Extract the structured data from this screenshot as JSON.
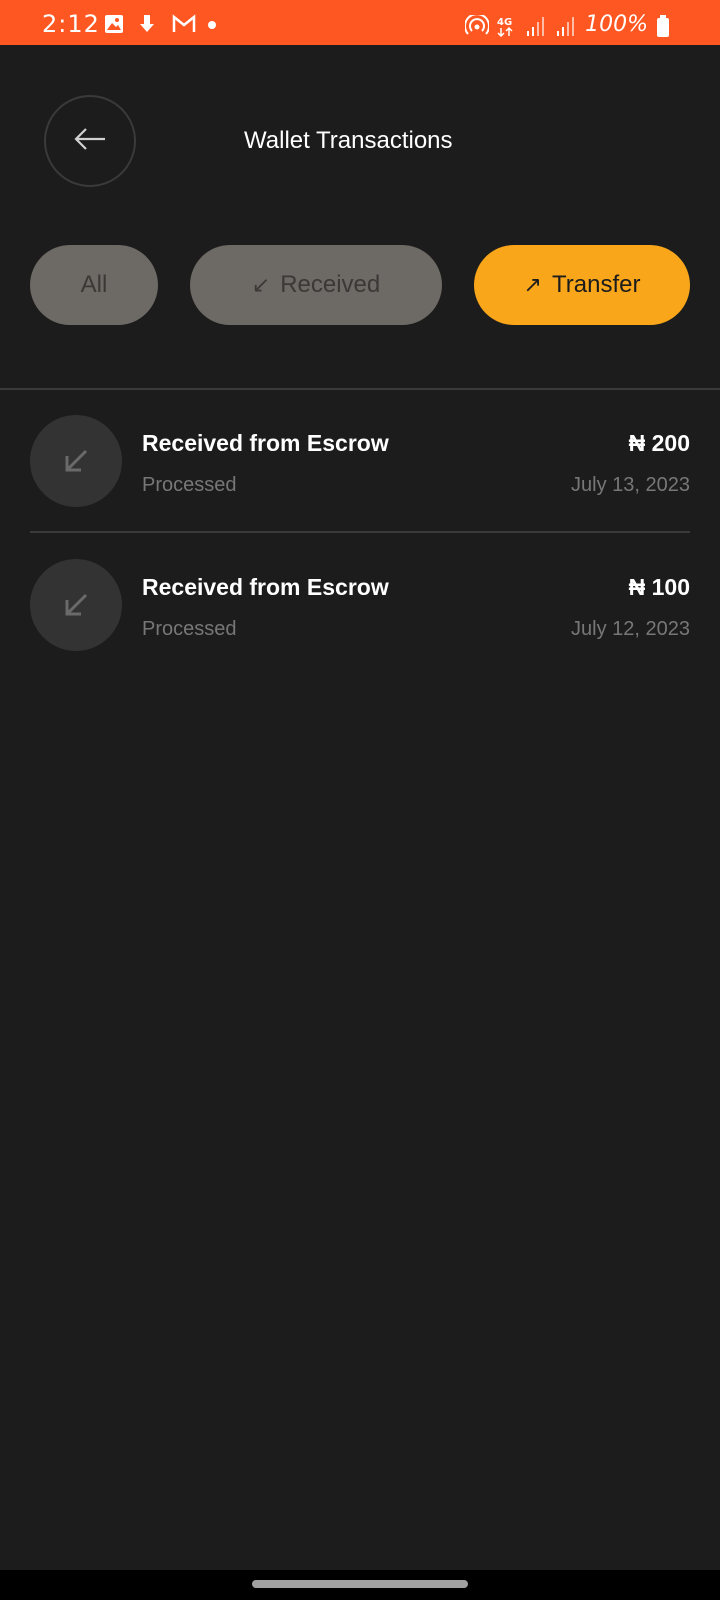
{
  "status_bar": {
    "time": "2:12",
    "battery_percent": "100%",
    "network": "4G",
    "icons_left": [
      "image-icon",
      "download-icon",
      "gmail-icon",
      "dot-icon"
    ],
    "icons_right": [
      "hotspot-icon",
      "network-4g-icon",
      "signal-icon",
      "signal-icon",
      "battery-icon"
    ]
  },
  "header": {
    "title": "Wallet Transactions",
    "back_icon": "arrow-left-icon"
  },
  "tabs": [
    {
      "label": "All",
      "active": false
    },
    {
      "label": "Received",
      "icon": "↙",
      "active": false
    },
    {
      "label": "Transfer",
      "icon": "↗",
      "active": true
    }
  ],
  "transactions": [
    {
      "title": "Received from Escrow",
      "status": "Processed",
      "amount": "₦ 200",
      "date": "July 13, 2023",
      "icon": "arrow-down-left-icon"
    },
    {
      "title": "Received from Escrow",
      "status": "Processed",
      "amount": "₦ 100",
      "date": "July 12, 2023",
      "icon": "arrow-down-left-icon"
    }
  ],
  "colors": {
    "status_bar": "#ff5722",
    "background": "#1c1c1c",
    "active_tab": "#f9a61a",
    "inactive_tab": "#6d6a66"
  }
}
